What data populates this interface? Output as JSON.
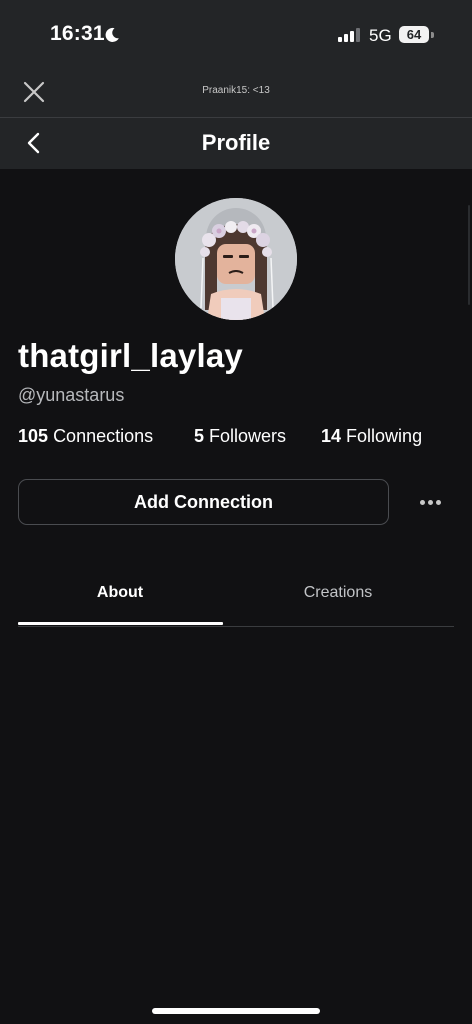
{
  "status_bar": {
    "time": "16:31",
    "moon_icon": "moon-icon",
    "signal_icon": "cellular-signal-icon",
    "network": "5G",
    "battery": "64"
  },
  "browser": {
    "close_icon": "close-icon",
    "url": "Praanik15: <13"
  },
  "nav": {
    "back_icon": "chevron-left-icon",
    "title": "Profile"
  },
  "profile": {
    "avatar_icon": "avatar-image",
    "display_name": "thatgirl_laylay",
    "username": "@yunastarus",
    "stats": {
      "connections_count": "105",
      "connections_label": "Connections",
      "followers_count": "5",
      "followers_label": "Followers",
      "following_count": "14",
      "following_label": "Following"
    }
  },
  "actions": {
    "add_connection_label": "Add Connection",
    "more_icon": "more-horizontal-icon"
  },
  "tabs": [
    {
      "label": "About",
      "selected": true
    },
    {
      "label": "Creations",
      "selected": false
    }
  ],
  "colors": {
    "background": "#111113",
    "chrome": "#232527",
    "text_primary": "#ffffff",
    "text_secondary": "#b7b9bc",
    "border": "#4a4c50"
  }
}
